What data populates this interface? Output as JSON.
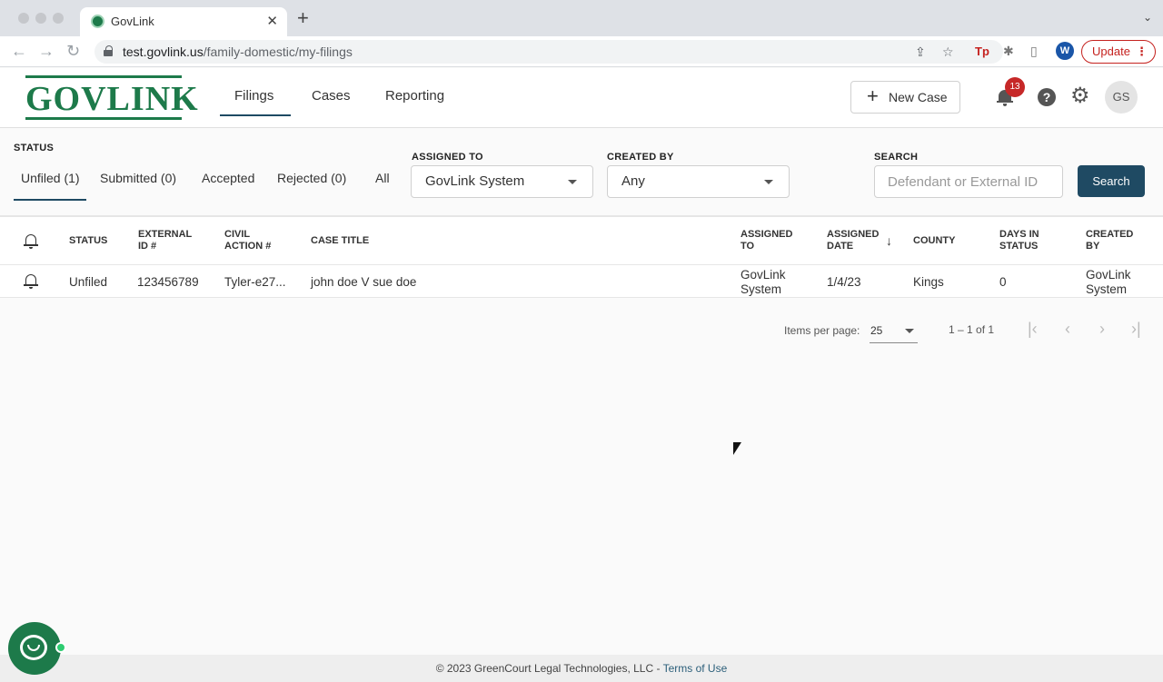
{
  "browser": {
    "tab_title": "GovLink",
    "url_host": "test.govlink.us",
    "url_path": "/family-domestic/my-filings",
    "profile_initial": "W",
    "update_label": "Update"
  },
  "header": {
    "logo_text": "GOVLINK",
    "nav": [
      "Filings",
      "Cases",
      "Reporting"
    ],
    "new_case_label": "New Case",
    "notification_count": "13",
    "avatar_initials": "GS"
  },
  "filters": {
    "status_label": "STATUS",
    "status_tabs": [
      "Unfiled (1)",
      "Submitted (0)",
      "Accepted",
      "Rejected (0)",
      "All"
    ],
    "assigned_to_label": "ASSIGNED TO",
    "assigned_to_value": "GovLink System",
    "created_by_label": "CREATED BY",
    "created_by_value": "Any",
    "search_label": "SEARCH",
    "search_placeholder": "Defendant or External ID",
    "search_button": "Search"
  },
  "table": {
    "headers": {
      "status": "STATUS",
      "external_id_1": "EXTERNAL",
      "external_id_2": "ID #",
      "civil_action_1": "CIVIL",
      "civil_action_2": "ACTION #",
      "case_title": "CASE TITLE",
      "assigned_to_1": "ASSIGNED",
      "assigned_to_2": "TO",
      "assigned_date_1": "ASSIGNED",
      "assigned_date_2": "DATE",
      "county": "COUNTY",
      "days_1": "DAYS IN",
      "days_2": "STATUS",
      "created_by_1": "CREATED",
      "created_by_2": "BY"
    },
    "rows": [
      {
        "status": "Unfiled",
        "external_id": "123456789",
        "civil_action": "Tyler-e27...",
        "case_title": "john doe V sue doe",
        "assigned_to_1": "GovLink",
        "assigned_to_2": "System",
        "assigned_date": "1/4/23",
        "county": "Kings",
        "days_in_status": "0",
        "created_by_1": "GovLink",
        "created_by_2": "System"
      }
    ]
  },
  "paginator": {
    "items_per_page_label": "Items per page:",
    "items_per_page_value": "25",
    "range_label": "1 – 1 of 1"
  },
  "footer": {
    "copyright": "© 2023 GreenCourt Legal Technologies, LLC - ",
    "terms_link": "Terms of Use"
  },
  "colors": {
    "brand_green": "#1d7a4a",
    "primary_navy": "#1f4a63",
    "badge_red": "#c62828"
  }
}
